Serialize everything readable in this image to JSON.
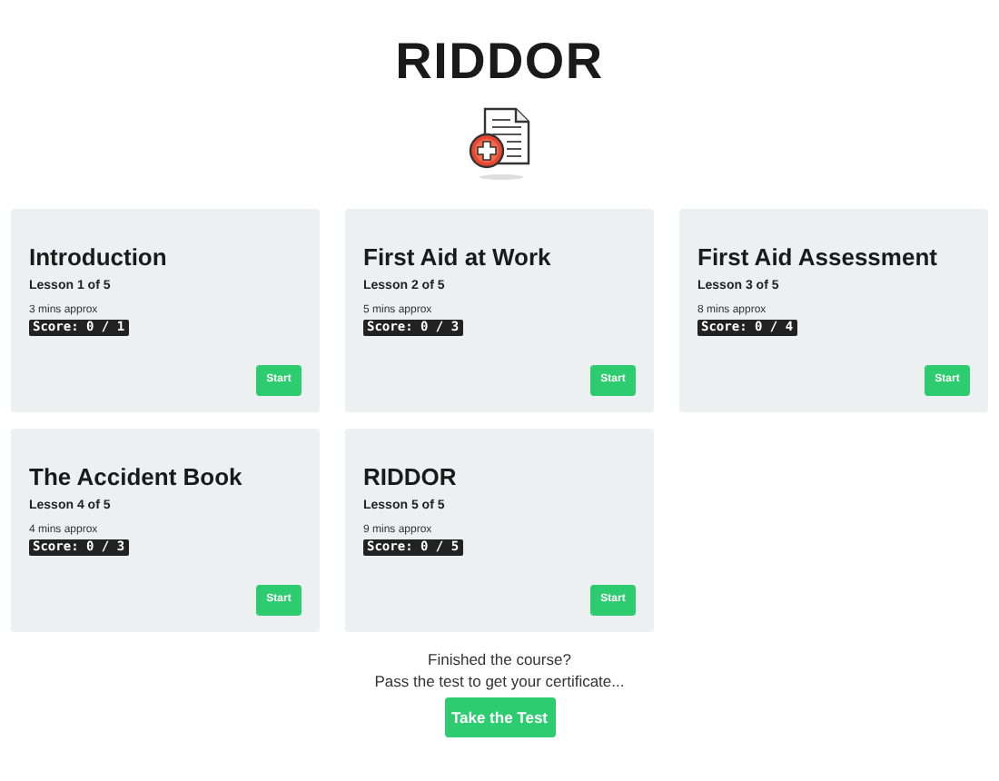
{
  "title": "RIDDOR",
  "lessons": [
    {
      "title": "Introduction",
      "lesson": "Lesson 1 of 5",
      "duration": "3 mins approx",
      "score": "Score: 0 / 1",
      "button": "Start"
    },
    {
      "title": "First Aid at Work",
      "lesson": "Lesson 2 of 5",
      "duration": "5 mins approx",
      "score": "Score: 0 / 3",
      "button": "Start"
    },
    {
      "title": "First Aid Assessment",
      "lesson": "Lesson 3 of 5",
      "duration": "8 mins approx",
      "score": "Score: 0 / 4",
      "button": "Start"
    },
    {
      "title": "The Accident Book",
      "lesson": "Lesson 4 of 5",
      "duration": "4 mins approx",
      "score": "Score: 0 / 3",
      "button": "Start"
    },
    {
      "title": "RIDDOR",
      "lesson": "Lesson 5 of 5",
      "duration": "9 mins approx",
      "score": "Score: 0 / 5",
      "button": "Start"
    }
  ],
  "footer": {
    "question": "Finished the course?",
    "prompt": "Pass the test to get your certificate...",
    "button": "Take the Test"
  }
}
